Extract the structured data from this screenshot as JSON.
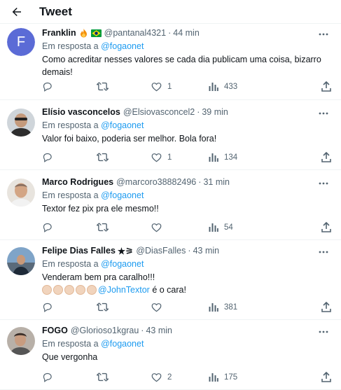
{
  "header": {
    "title": "Tweet"
  },
  "tweets": [
    {
      "name": "Franklin",
      "badges": [
        "fire-emoji",
        "brazil-flag-emoji"
      ],
      "handle": "@pantanal4321",
      "time": "44 min",
      "avatar_letter": "F",
      "reply_prefix": "Em resposta a ",
      "reply_to": "@fogaonet",
      "text": "Como acreditar nesses valores se cada dia publicam uma coisa, bizarro demais!",
      "likes": "1",
      "views": "433"
    },
    {
      "name": "Elísio vasconcelos",
      "handle": "@Elsiovasconcel2",
      "time": "39 min",
      "reply_prefix": "Em resposta a ",
      "reply_to": "@fogaonet",
      "text": "Valor foi baixo, poderia ser melhor. Bola fora!",
      "likes": "1",
      "views": "134"
    },
    {
      "name": "Marco Rodrigues",
      "handle": "@marcoro38882496",
      "time": "31 min",
      "reply_prefix": "Em resposta a ",
      "reply_to": "@fogaonet",
      "text": "Textor fez pix pra ele mesmo!!",
      "likes": "",
      "views": "54"
    },
    {
      "name": "Felipe Dias Falles",
      "name_suffix": "★⚞",
      "handle": "@DiasFalles",
      "time": "43 min",
      "reply_prefix": "Em resposta a ",
      "reply_to": "@fogaonet",
      "text": "Venderam bem pra caralho!!!",
      "mention2": "@JohnTextor",
      "text2": " é o cara!",
      "likes": "",
      "views": "381"
    },
    {
      "name": "FOGO",
      "handle": "@Glorioso1kgrau",
      "time": "43 min",
      "reply_prefix": "Em resposta a ",
      "reply_to": "@fogaonet",
      "text": "Que vergonha",
      "likes": "2",
      "views": "175"
    }
  ],
  "colors": {
    "accent": "#1d9bf0",
    "muted": "#536471",
    "text": "#0f1419",
    "divider": "#eff3f4"
  }
}
